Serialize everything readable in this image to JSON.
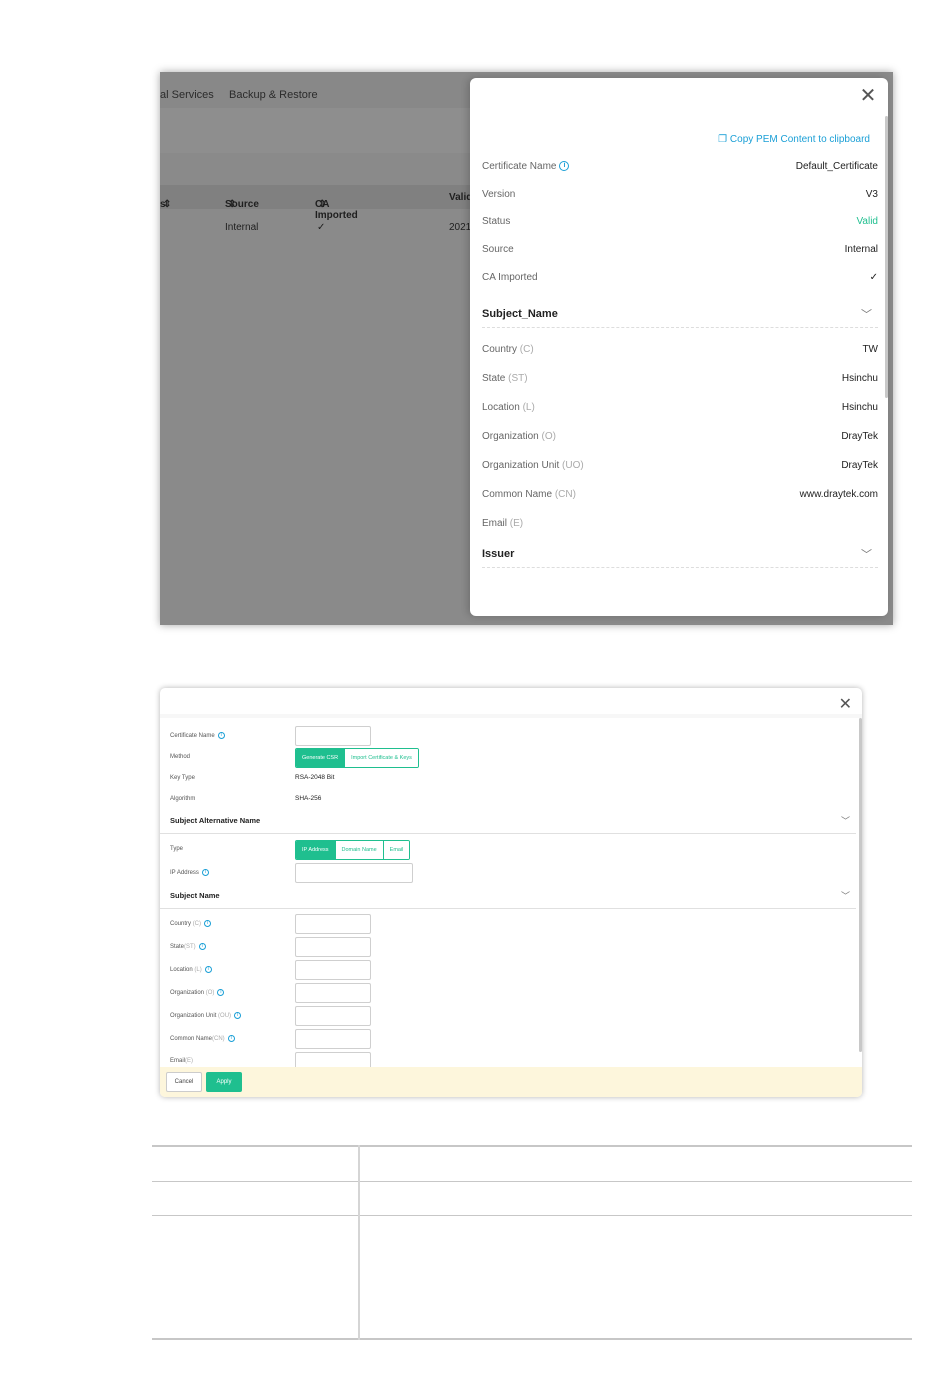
{
  "background_page": {
    "nav": [
      "al Services",
      "Backup & Restore"
    ],
    "table_headers": [
      "s",
      "Source",
      "CA Imported",
      "Valid"
    ],
    "row": {
      "source": "Internal",
      "ca_imported": "✓",
      "valid": "2021"
    }
  },
  "drawer": {
    "copy_label": "Copy PEM Content to clipboard",
    "fields": [
      {
        "label": "Certificate Name",
        "value": "Default_Certificate",
        "info": true
      },
      {
        "label": "Version",
        "value": "V3"
      },
      {
        "label": "Status",
        "value": "Valid"
      },
      {
        "label": "Source",
        "value": "Internal"
      },
      {
        "label": "CA Imported",
        "value": "✓"
      }
    ],
    "subject_section": "Subject_Name",
    "subject_fields": [
      {
        "label": "Country",
        "abbr": "(C)",
        "value": "TW"
      },
      {
        "label": "State",
        "abbr": "(ST)",
        "value": "Hsinchu"
      },
      {
        "label": "Location",
        "abbr": "(L)",
        "value": "Hsinchu"
      },
      {
        "label": "Organization",
        "abbr": "(O)",
        "value": "DrayTek"
      },
      {
        "label": "Organization Unit",
        "abbr": "(UO)",
        "value": "DrayTek"
      },
      {
        "label": "Common Name",
        "abbr": "(CN)",
        "value": "www.draytek.com"
      },
      {
        "label": "Email",
        "abbr": "(E)",
        "value": ""
      }
    ],
    "issuer_section": "Issuer"
  },
  "form": {
    "certificate_name_label": "Certificate Name",
    "method_label": "Method",
    "method_options": [
      "Generate CSR",
      "Import Certificate & Keys"
    ],
    "key_type_label": "Key Type",
    "key_type_value": "RSA-2048 Bit",
    "algorithm_label": "Algorithm",
    "algorithm_value": "SHA-256",
    "san_section": "Subject Alternative Name",
    "type_label": "Type",
    "type_options": [
      "IP Address",
      "Domain Name",
      "Email"
    ],
    "ip_label": "IP Address",
    "subject_section": "Subject Name",
    "subject_fields": [
      {
        "label": "Country",
        "abbr": "(C)"
      },
      {
        "label": "State",
        "abbr": "(ST)"
      },
      {
        "label": "Location",
        "abbr": "(L)"
      },
      {
        "label": "Organization",
        "abbr": "(O)"
      },
      {
        "label": "Organization Unit",
        "abbr": "(OU)"
      },
      {
        "label": "Common Name",
        "abbr": "(CN)"
      },
      {
        "label": "Email",
        "abbr": "(E)"
      }
    ],
    "cancel_label": "Cancel",
    "apply_label": "Apply"
  },
  "colors": {
    "accent": "#1fbf8f",
    "link": "#1a9fd6"
  }
}
